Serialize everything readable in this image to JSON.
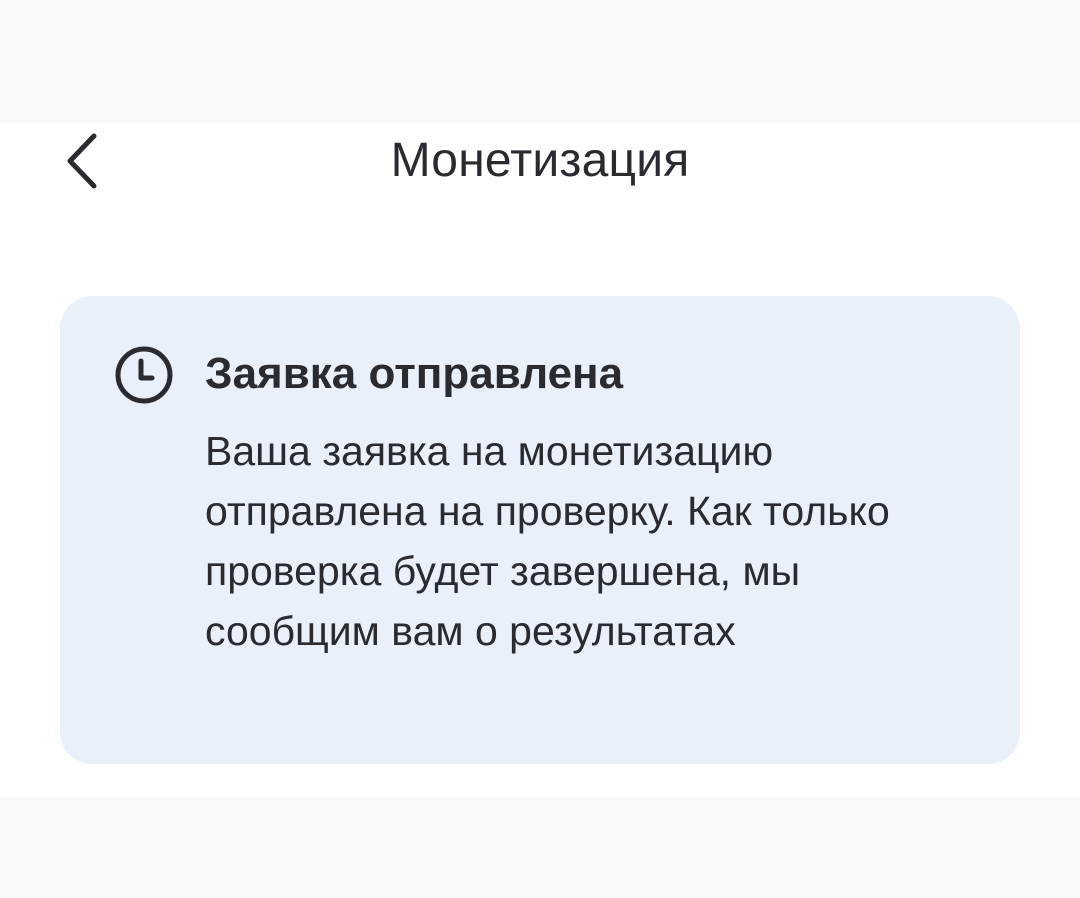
{
  "header": {
    "back_icon": "chevron-left-icon",
    "title": "Монетизация"
  },
  "status_card": {
    "icon": "clock-icon",
    "title": "Заявка отправлена",
    "message": "Ваша заявка на монетизацию отправлена на проверку. Как только проверка будет завершена, мы сообщим вам о результатах",
    "background_color": "#e9f0f9"
  },
  "colors": {
    "text": "#2a2b30",
    "page_background": "#ffffff",
    "outer_background": "#f9f9f9"
  }
}
